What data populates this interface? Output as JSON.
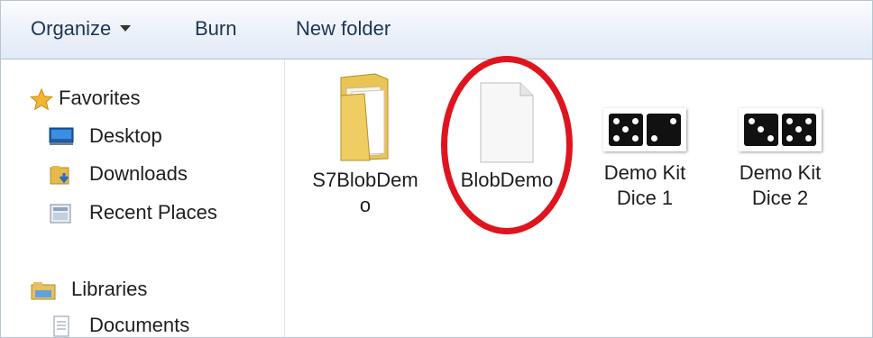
{
  "toolbar": {
    "organize_label": "Organize",
    "burn_label": "Burn",
    "new_folder_label": "New folder"
  },
  "nav": {
    "favorites": {
      "label": "Favorites",
      "items": [
        {
          "label": "Desktop"
        },
        {
          "label": "Downloads"
        },
        {
          "label": "Recent Places"
        }
      ]
    },
    "libraries": {
      "label": "Libraries",
      "items": [
        {
          "label": "Documents"
        }
      ]
    }
  },
  "files": [
    {
      "name_line1": "S7BlobDem",
      "name_line2": "o",
      "type": "folder"
    },
    {
      "name_line1": "BlobDemo",
      "name_line2": "",
      "type": "file"
    },
    {
      "name_line1": "Demo Kit",
      "name_line2": "Dice 1",
      "type": "dice"
    },
    {
      "name_line1": "Demo Kit",
      "name_line2": "Dice 2",
      "type": "dice"
    }
  ],
  "colors": {
    "highlight": "#e0141e",
    "toolbar_text": "#1e3554"
  }
}
